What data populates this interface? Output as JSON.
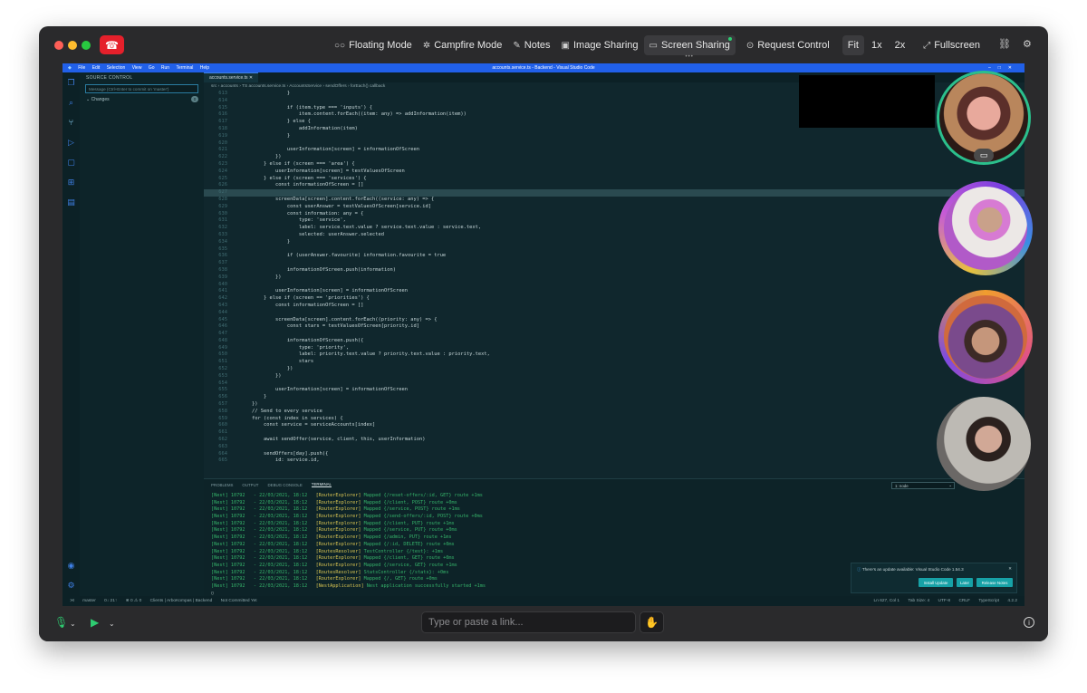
{
  "toolbar": {
    "items": [
      {
        "label": "Floating Mode",
        "icon": "floating-icon"
      },
      {
        "label": "Campfire Mode",
        "icon": "campfire-icon"
      },
      {
        "label": "Notes",
        "icon": "notes-icon"
      },
      {
        "label": "Image Sharing",
        "icon": "image-icon"
      },
      {
        "label": "Screen Sharing",
        "icon": "screen-icon"
      },
      {
        "label": "Request Control",
        "icon": "request-control-icon"
      },
      {
        "label": "Fit"
      },
      {
        "label": "1x"
      },
      {
        "label": "2x"
      },
      {
        "label": "Fullscreen",
        "icon": "fullscreen-icon"
      }
    ]
  },
  "vscode": {
    "menu": [
      "File",
      "Edit",
      "Selection",
      "View",
      "Go",
      "Run",
      "Terminal",
      "Help"
    ],
    "title": "accounts.service.ts - Backend - Visual Studio Code",
    "sidebar_title": "SOURCE CONTROL",
    "message_placeholder": "Message (Ctrl+Enter to commit on 'master')",
    "changes_label": "Changes",
    "changes_count": "0",
    "tab": "accounts.service.ts",
    "breadcrumb": "src › accounts › TS accounts.service.ts › AccountsService › sendOffers › forEach() callback",
    "code_lines": [
      [
        "613",
        "                }"
      ],
      [
        "614",
        ""
      ],
      [
        "615",
        "                if (item.type === 'inputs') {"
      ],
      [
        "616",
        "                    item.content.forEach((item: any) => addInformation(item))"
      ],
      [
        "617",
        "                } else {"
      ],
      [
        "618",
        "                    addInformation(item)"
      ],
      [
        "619",
        "                }"
      ],
      [
        "620",
        ""
      ],
      [
        "621",
        "                userInformation[screen] = informationOfScreen"
      ],
      [
        "622",
        "            })"
      ],
      [
        "623",
        "        } else if (screen === 'area') {"
      ],
      [
        "624",
        "            userInformation[screen] = testValuesOfScreen"
      ],
      [
        "625",
        "        } else if (screen === 'services') {"
      ],
      [
        "626",
        "            const informationOfScreen = []"
      ],
      [
        "627",
        ""
      ],
      [
        "628",
        "            screenData[screen].content.forEach((service: any) => {"
      ],
      [
        "629",
        "                const userAnswer = testValuesOfScreen[service.id]"
      ],
      [
        "630",
        "                const information: any = {"
      ],
      [
        "631",
        "                    type: 'service',"
      ],
      [
        "632",
        "                    label: service.text.value ? service.text.value : service.text,"
      ],
      [
        "633",
        "                    selected: userAnswer.selected"
      ],
      [
        "634",
        "                }"
      ],
      [
        "635",
        ""
      ],
      [
        "636",
        "                if (userAnswer.favourite) information.favourite = true"
      ],
      [
        "637",
        ""
      ],
      [
        "638",
        "                informationOfScreen.push(information)"
      ],
      [
        "639",
        "            })"
      ],
      [
        "640",
        ""
      ],
      [
        "641",
        "            userInformation[screen] = informationOfScreen"
      ],
      [
        "642",
        "        } else if (screen == 'priorities') {"
      ],
      [
        "643",
        "            const informationOfScreen = []"
      ],
      [
        "644",
        ""
      ],
      [
        "645",
        "            screenData[screen].content.forEach((priority: any) => {"
      ],
      [
        "646",
        "                const stars = testValuesOfScreen[priority.id]"
      ],
      [
        "647",
        ""
      ],
      [
        "648",
        "                informationOfScreen.push({"
      ],
      [
        "649",
        "                    type: 'priority',"
      ],
      [
        "650",
        "                    label: priority.text.value ? priority.text.value : priority.text,"
      ],
      [
        "651",
        "                    stars"
      ],
      [
        "652",
        "                })"
      ],
      [
        "653",
        "            })"
      ],
      [
        "654",
        ""
      ],
      [
        "655",
        "            userInformation[screen] = informationOfScreen"
      ],
      [
        "656",
        "        }"
      ],
      [
        "657",
        "    })"
      ],
      [
        "658",
        "    // Send to every service"
      ],
      [
        "659",
        "    for (const index in services) {"
      ],
      [
        "660",
        "        const service = serviceAccounts[index]"
      ],
      [
        "661",
        ""
      ],
      [
        "662",
        "        await sendOffer(service, client, this, userInformation)"
      ],
      [
        "663",
        ""
      ],
      [
        "664",
        "        sendOffers[day].push({"
      ],
      [
        "665",
        "            id: service.id,"
      ]
    ],
    "panel_tabs": [
      "PROBLEMS",
      "OUTPUT",
      "DEBUG CONSOLE",
      "TERMINAL"
    ],
    "terminal_select": "1: node",
    "terminal_lines": [
      [
        "[Nest] 10792   - 22/03/2021, 18:12   ",
        "[RouterExplorer]",
        " Mapped {/reset-offers/:id, GET} route +1ms"
      ],
      [
        "[Nest] 10792   - 22/03/2021, 18:12   ",
        "[RouterExplorer]",
        " Mapped {/client, POST} route +0ms"
      ],
      [
        "[Nest] 10792   - 22/03/2021, 18:12   ",
        "[RouterExplorer]",
        " Mapped {/service, POST} route +1ms"
      ],
      [
        "[Nest] 10792   - 22/03/2021, 18:12   ",
        "[RouterExplorer]",
        " Mapped {/send-offers/:id, POST} route +0ms"
      ],
      [
        "[Nest] 10792   - 22/03/2021, 18:12   ",
        "[RouterExplorer]",
        " Mapped {/client, PUT} route +1ms"
      ],
      [
        "[Nest] 10792   - 22/03/2021, 18:12   ",
        "[RouterExplorer]",
        " Mapped {/service, PUT} route +0ms"
      ],
      [
        "[Nest] 10792   - 22/03/2021, 18:12   ",
        "[RouterExplorer]",
        " Mapped {/admin, PUT} route +1ms"
      ],
      [
        "[Nest] 10792   - 22/03/2021, 18:12   ",
        "[RouterExplorer]",
        " Mapped {/:id, DELETE} route +0ms"
      ],
      [
        "[Nest] 10792   - 22/03/2021, 18:12   ",
        "[RoutesResolver]",
        " TestController {/test}: +1ms"
      ],
      [
        "[Nest] 10792   - 22/03/2021, 18:12   ",
        "[RouterExplorer]",
        " Mapped {/client, GET} route +0ms"
      ],
      [
        "[Nest] 10792   - 22/03/2021, 18:12   ",
        "[RouterExplorer]",
        " Mapped {/service, GET} route +1ms"
      ],
      [
        "[Nest] 10792   - 22/03/2021, 18:12   ",
        "[RoutesResolver]",
        " StatsController {/stats}: +0ms"
      ],
      [
        "[Nest] 10792   - 22/03/2021, 18:12   ",
        "[RouterExplorer]",
        " Mapped {/, GET} route +0ms"
      ],
      [
        "[Nest] 10792   - 22/03/2021, 18:12   ",
        "[NestApplication]",
        " Nest application successfully started +1ms"
      ]
    ],
    "notification": {
      "message": "There's an update available: Visual Studio Code 1.54.3",
      "buttons": [
        "Install Update",
        "Later",
        "Release Notes"
      ]
    },
    "status_left": [
      "master",
      "0↓ 21↑",
      "⊗ 0 ⚠ 0",
      "Clients | ArboKompas | Backend",
      "Not Committed Yet"
    ],
    "status_right": [
      "Ln 627, Col 1",
      "Tab Size: 4",
      "UTF-8",
      "CRLF",
      "TypeScript",
      "4.2.2"
    ]
  },
  "bottom": {
    "link_placeholder": "Type or paste a link..."
  },
  "colors": {
    "accent_green": "#2ecc71",
    "hangup_red": "#e5202b",
    "vscode_blue": "#2160e9"
  }
}
